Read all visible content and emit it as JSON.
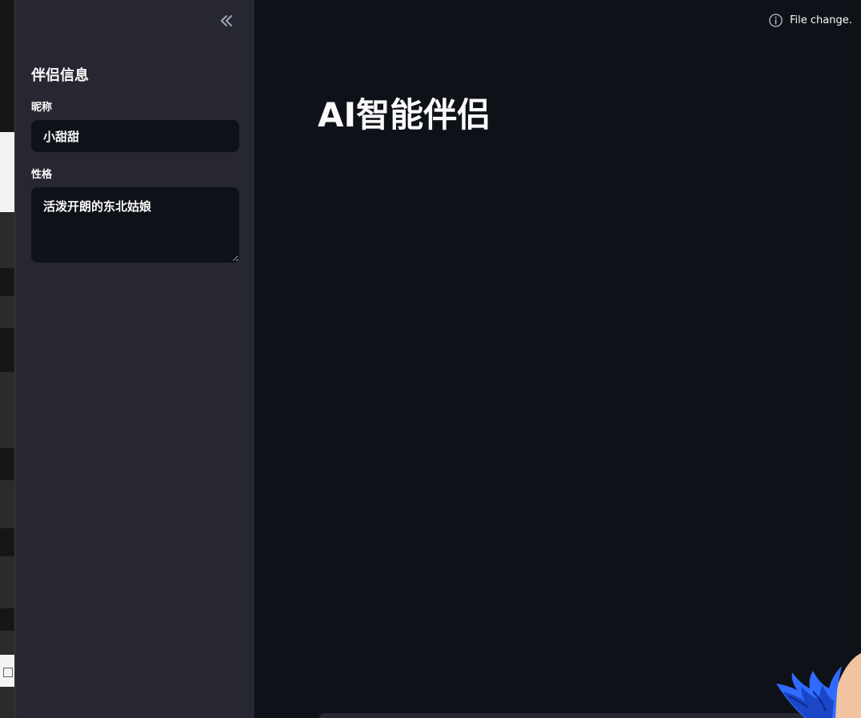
{
  "app": {
    "title": "AI智能伴侣",
    "status_text": "File change."
  },
  "sidebar": {
    "header": "伴侣信息",
    "nickname": {
      "label": "昵称",
      "value": "小甜甜"
    },
    "personality": {
      "label": "性格",
      "value": "活泼开朗的东北姑娘"
    }
  },
  "icons": {
    "collapse": "chevron-double-left-icon",
    "status": "info-icon",
    "mascot": "anime-character-icon"
  },
  "colors": {
    "background": "#0e1117",
    "sidebar": "#262730",
    "text": "#fafafa",
    "muted": "#a3a8b8",
    "mascot_hair": "#2f6bff",
    "mascot_skin": "#f2c3a0"
  }
}
